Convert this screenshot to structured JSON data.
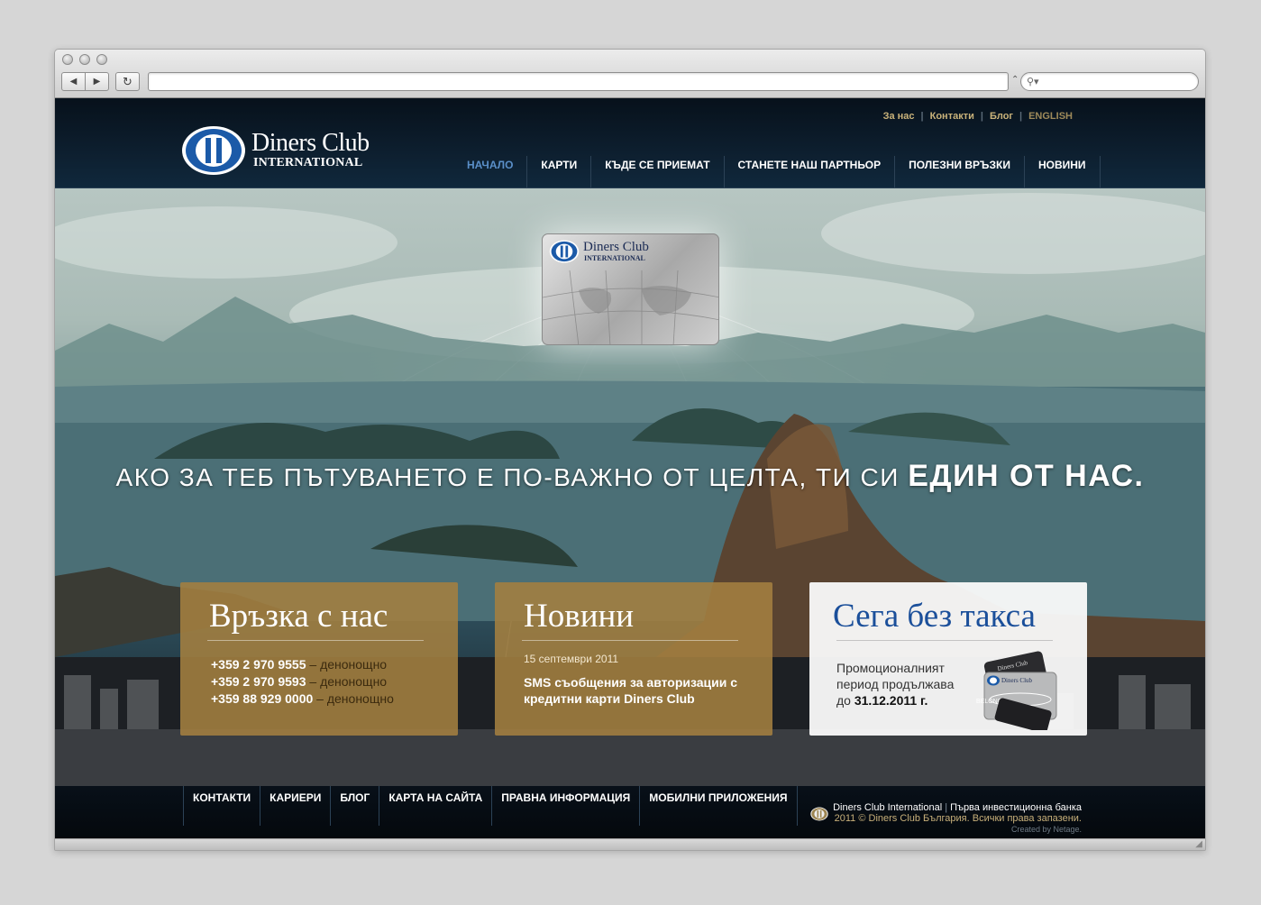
{
  "browser": {
    "back_label": "◀",
    "forward_label": "▶",
    "reload_label": "↻",
    "address_value": "",
    "search_value": "",
    "search_glyph": "⚲▾",
    "caret": "⌃"
  },
  "header": {
    "logo_line1": "Diners Club",
    "logo_line2": "INTERNATIONAL",
    "util_links": [
      "За нас",
      "Контакти",
      "Блог"
    ],
    "lang_link": "ENGLISH",
    "nav": [
      {
        "label": "НАЧАЛО",
        "active": true
      },
      {
        "label": "КАРТИ"
      },
      {
        "label": "КЪДЕ СЕ ПРИЕМАТ"
      },
      {
        "label": "СТАНЕТЕ НАШ ПАРТНЬОР"
      },
      {
        "label": "ПОЛЕЗНИ ВРЪЗКИ"
      },
      {
        "label": "НОВИНИ"
      }
    ]
  },
  "hero": {
    "card_line1": "Diners Club",
    "card_line2": "INTERNATIONAL",
    "slogan_main": "АКО ЗА ТЕБ ПЪТУВАНЕТО Е ПО-ВАЖНО ОТ ЦЕЛТА, ТИ СИ",
    "slogan_emph": "ЕДИН ОТ НАС."
  },
  "contact_box": {
    "title": "Връзка с нас",
    "phones": [
      {
        "number": "+359 2 970 9555",
        "note": "– денонощно"
      },
      {
        "number": "+359 2 970 9593",
        "note": "– денонощно"
      },
      {
        "number": "+359 88 929 0000",
        "note": "– денонощно"
      }
    ]
  },
  "news_box": {
    "title": "Новини",
    "date": "15 септември 2011",
    "headline": "SMS съобщения за авторизации с кредитни карти Diners Club"
  },
  "promo_box": {
    "title": "Сега без такса",
    "text": "Промоционалният период продължава до",
    "date": "31.12.2011 г.",
    "card_word": "BELONG"
  },
  "footer": {
    "nav": [
      "КОНТАКТИ",
      "КАРИЕРИ",
      "БЛОГ",
      "КАРТА НА САЙТА",
      "ПРАВНА ИНФОРМАЦИЯ",
      "МОБИЛНИ ПРИЛОЖЕНИЯ"
    ],
    "company": "Diners Club International",
    "bank": "Първа инвестиционна банка",
    "copyright": "2011 © Diners Club България. Всички права запазени.",
    "credit": "Created by Netage."
  },
  "colors": {
    "brand_blue": "#1b4f9a",
    "gold": "#a48040",
    "nav_active": "#5a8fc8",
    "util_gold": "#c9b27a"
  }
}
